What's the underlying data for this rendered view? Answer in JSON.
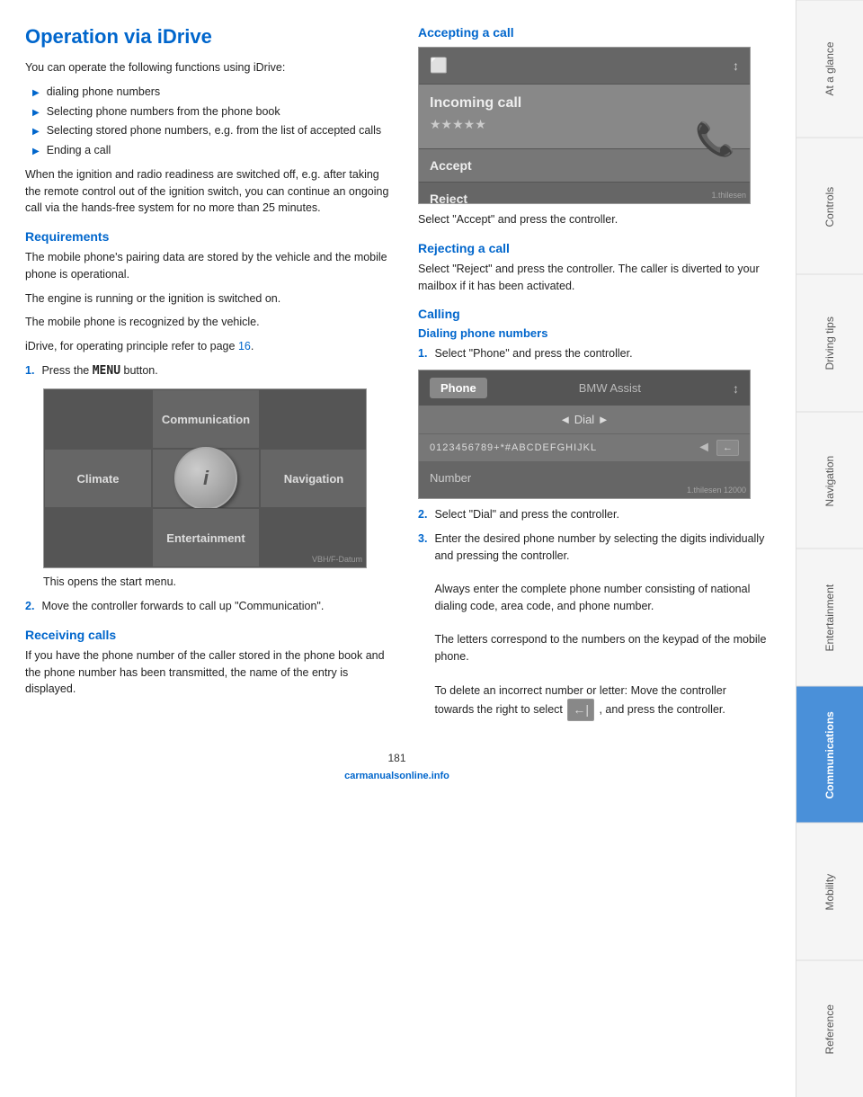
{
  "page": {
    "title": "Operation via iDrive",
    "number": "181"
  },
  "left_col": {
    "intro": "You can operate the following functions using iDrive:",
    "bullets": [
      "dialing phone numbers",
      "Selecting phone numbers from the phone book",
      "Selecting stored phone numbers, e.g. from the list of accepted calls",
      "Ending a call"
    ],
    "ignition_note": "When the ignition and radio readiness are switched off, e.g. after taking the remote control out of the ignition switch, you can continue an ongoing call via the hands-free system for no more than 25 minutes.",
    "requirements": {
      "heading": "Requirements",
      "p1": "The mobile phone's pairing data are stored by the vehicle and the mobile phone is operational.",
      "p2": "The engine is running or the ignition is switched on.",
      "p3": "The mobile phone is recognized by the vehicle.",
      "p4_prefix": "iDrive, for operating principle refer to page ",
      "p4_link": "16",
      "p4_suffix": "."
    },
    "step1": {
      "num": "1.",
      "text_prefix": "Press the ",
      "menu_word": "MENU",
      "text_suffix": " button."
    },
    "menu_labels": {
      "communication": "Communication",
      "climate": "Climate",
      "navigation": "Navigation",
      "entertainment": "Entertainment",
      "center_label": "i"
    },
    "step1_caption": "This opens the start menu.",
    "step2": {
      "num": "2.",
      "text": "Move the controller forwards to call up \"Communication\"."
    },
    "receiving_calls": {
      "heading": "Receiving calls",
      "text": "If you have the phone number of the caller stored in the phone book and the phone number has been transmitted, the name of the entry is displayed."
    }
  },
  "right_col": {
    "accepting_call": {
      "heading": "Accepting a call",
      "incoming_label": "Incoming call",
      "stars": "★★★★★",
      "accept_btn": "Accept",
      "reject_btn": "Reject",
      "instruction": "Select \"Accept\" and press the controller."
    },
    "rejecting_call": {
      "heading": "Rejecting a call",
      "text": "Select \"Reject\" and press the controller. The caller is diverted to your mailbox if it has been activated."
    },
    "calling": {
      "heading": "Calling"
    },
    "dialing": {
      "heading": "Dialing phone numbers",
      "step1": {
        "num": "1.",
        "text": "Select \"Phone\" and press the controller."
      },
      "phone_tab": "Phone",
      "bmw_tab": "BMW Assist",
      "dial_label": "◄ Dial ►",
      "keypad": "0123456789+*#ABCDEFGHIJKL",
      "number_label": "Number",
      "step2": {
        "num": "2.",
        "text": "Select \"Dial\" and press the controller."
      },
      "step3": {
        "num": "3.",
        "text_parts": [
          "Enter the desired phone number by selecting the digits individually and pressing the controller.",
          "Always enter the complete phone number consisting of national dialing code, area code, and phone number.",
          "The letters correspond to the numbers on the keypad of the mobile phone.",
          "To delete an incorrect number or letter: Move the controller towards the right to select",
          ", and press the controller."
        ]
      }
    }
  },
  "sidebar": {
    "tabs": [
      {
        "label": "At a glance",
        "active": false
      },
      {
        "label": "Controls",
        "active": false
      },
      {
        "label": "Driving tips",
        "active": false
      },
      {
        "label": "Navigation",
        "active": false
      },
      {
        "label": "Entertainment",
        "active": false
      },
      {
        "label": "Communications",
        "active": true
      },
      {
        "label": "Mobility",
        "active": false
      },
      {
        "label": "Reference",
        "active": false
      }
    ]
  },
  "footer": {
    "logo": "carmanualsonline.info"
  }
}
